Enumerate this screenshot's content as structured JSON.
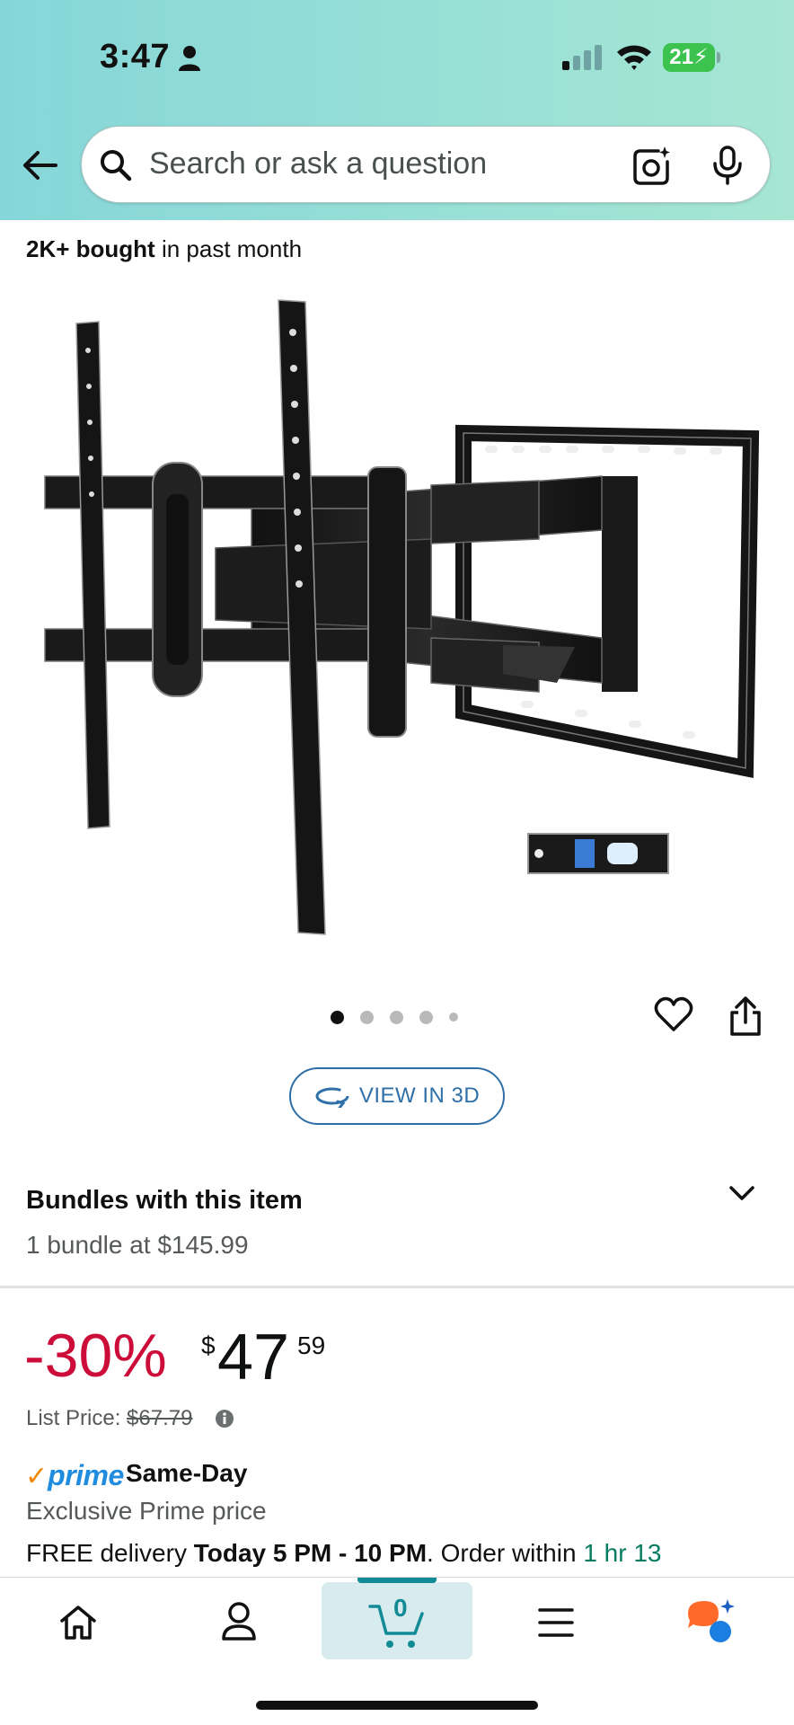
{
  "status_bar": {
    "time": "3:47",
    "battery": "21"
  },
  "search": {
    "placeholder": "Search or ask a question"
  },
  "product": {
    "bought_bold": "2K+ bought",
    "bought_rest": " in past month",
    "image_count": 5,
    "active_image": 1,
    "view_3d_label": "VIEW IN 3D"
  },
  "bundles": {
    "title": "Bundles with this item",
    "subtitle": "1 bundle at $145.99"
  },
  "price": {
    "discount": "-30%",
    "currency": "$",
    "whole": "47",
    "fraction": "59",
    "list_label": "List Price: ",
    "list_value": "$67.79"
  },
  "prime": {
    "check": "✓",
    "word": "prime",
    "same_day": "Same-Day",
    "exclusive": "Exclusive Prime price"
  },
  "delivery": {
    "prefix": "FREE delivery ",
    "window": "Today 5 PM - 10 PM",
    "middle": ". Order within ",
    "countdown": "1 hr 13"
  },
  "nav": {
    "cart_count": "0"
  },
  "colors": {
    "discount_red": "#cc0c39",
    "prime_blue": "#1f8ce0",
    "prime_orange": "#f08804",
    "accent_teal": "#138b96",
    "countdown_green": "#067d62",
    "link_blue": "#2f6fa7"
  }
}
